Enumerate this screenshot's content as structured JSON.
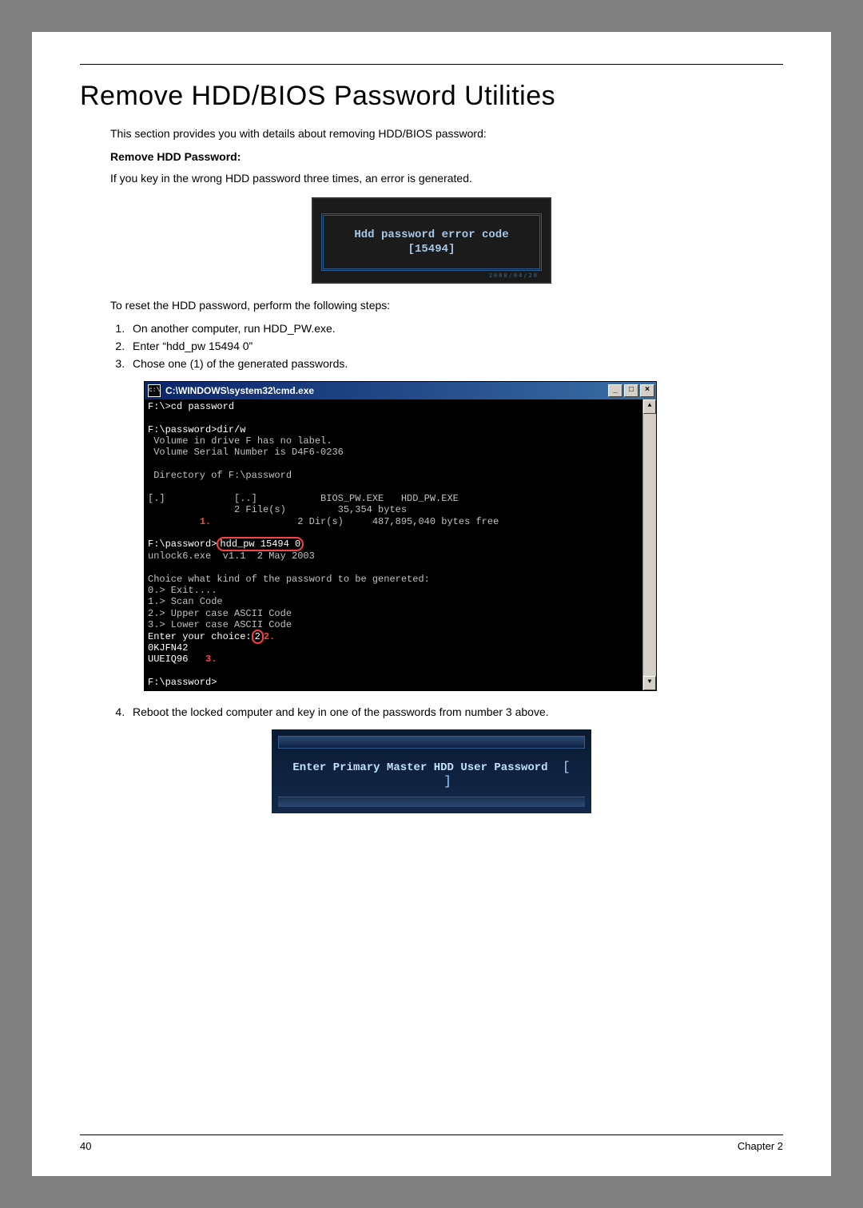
{
  "title": "Remove HDD/BIOS Password Utilities",
  "intro": "This section provides you with details about removing HDD/BIOS password:",
  "subhead": "Remove HDD Password:",
  "wrong_pw_text": "If you key in the wrong HDD password three times, an error is generated.",
  "fig1": {
    "line1": "Hdd password error code",
    "line2": "[15494]",
    "tag": "2008/04/20"
  },
  "reset_intro": "To reset the HDD password, perform the following steps:",
  "steps_a": [
    "On another computer, run HDD_PW.exe.",
    "Enter “hdd_pw 15494 0”",
    "Chose one (1) of the generated passwords."
  ],
  "cmd": {
    "title": "C:\\WINDOWS\\system32\\cmd.exe",
    "icon": "c:\\",
    "min": "_",
    "max": "□",
    "close": "×",
    "scroll_up": "▲",
    "scroll_down": "▼",
    "line1": "F:\\>cd password",
    "line2": "F:\\password>dir/w",
    "line3": " Volume in drive F has no label.",
    "line4": " Volume Serial Number is D4F6-0236",
    "line5": " Directory of F:\\password",
    "line6": "[.]            [..]           BIOS_PW.EXE   HDD_PW.EXE",
    "line7": "               2 File(s)         35,354 bytes",
    "line8": "               2 Dir(s)     487,895,040 bytes free",
    "hl_cmd": "hdd_pw 15494 0",
    "line9a": "F:\\password>",
    "line10": "unlock6.exe  v1.1  2 May 2003",
    "line11": "Choice what kind of the password to be genereted:",
    "line12": "0.> Exit....",
    "line13": "1.> Scan Code",
    "line14": "2.> Upper case ASCII Code",
    "line15": "3.> Lower case ASCII Code",
    "line16a": "Enter your choice:",
    "line16b": "2",
    "line17": "0KJFN42",
    "line18": "UUEIQ96",
    "line19": "F:\\password>",
    "anno1": "1.",
    "anno2": "2.",
    "anno3": "3."
  },
  "step4": "Reboot the locked computer and key in one of the passwords from number 3 above.",
  "fig3": {
    "msg": "Enter Primary Master HDD User Password",
    "bracket_open": "[",
    "bracket_close": "]"
  },
  "footer": {
    "page": "40",
    "chapter": "Chapter 2"
  }
}
